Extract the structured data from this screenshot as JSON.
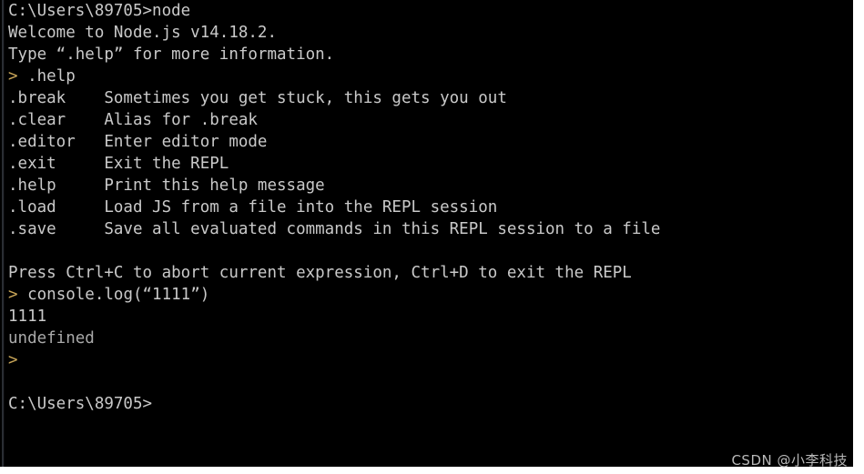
{
  "window": {
    "kind": "windows-command-prompt",
    "program": "node-repl",
    "background_color": "#000000",
    "text_color": "#c9c9c9",
    "prompt_color": "#c9a658"
  },
  "console": {
    "lines": [
      {
        "id": "cmd-node",
        "text": "C:\\Users\\89705>node"
      },
      {
        "id": "welcome",
        "text": "Welcome to Node.js v14.18.2."
      },
      {
        "id": "type-help-hint",
        "text": "Type “.help” for more information."
      },
      {
        "id": "repl-cmd-help",
        "text": "> .help",
        "prompt": true
      },
      {
        "id": "help-break",
        "text": ".break    Sometimes you get stuck, this gets you out"
      },
      {
        "id": "help-clear",
        "text": ".clear    Alias for .break"
      },
      {
        "id": "help-editor",
        "text": ".editor   Enter editor mode"
      },
      {
        "id": "help-exit",
        "text": ".exit     Exit the REPL"
      },
      {
        "id": "help-help",
        "text": ".help     Print this help message"
      },
      {
        "id": "help-load",
        "text": ".load     Load JS from a file into the REPL session"
      },
      {
        "id": "help-save",
        "text": ".save     Save all evaluated commands in this REPL session to a file"
      },
      {
        "id": "blank-1",
        "text": ""
      },
      {
        "id": "abort-hint",
        "text": "Press Ctrl+C to abort current expression, Ctrl+D to exit the REPL"
      },
      {
        "id": "repl-cmd-log",
        "text": "> console.log(“1111”)",
        "prompt": true
      },
      {
        "id": "output-1111",
        "text": "1111"
      },
      {
        "id": "output-undefined",
        "text": "undefined",
        "dim": true
      },
      {
        "id": "repl-prompt-idle",
        "text": ">",
        "prompt": true
      },
      {
        "id": "blank-2",
        "text": ""
      },
      {
        "id": "shell-prompt",
        "text": "C:\\Users\\89705>"
      }
    ]
  },
  "watermark": {
    "text": "CSDN @小李科技"
  }
}
